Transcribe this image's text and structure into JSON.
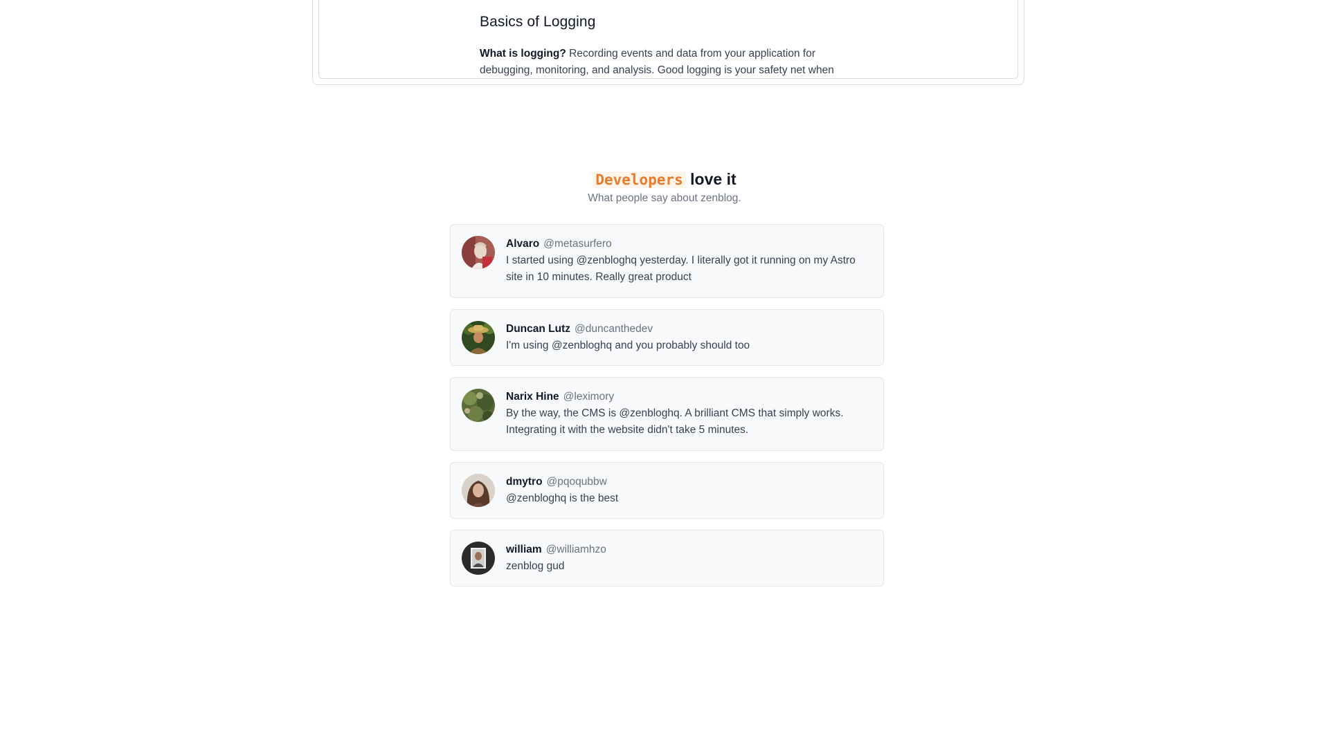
{
  "preview": {
    "title": "Basics of Logging",
    "lead_bold": "What is logging?",
    "lead_text": " Recording events and data from your application for debugging, monitoring, and analysis. Good logging is your safety net when"
  },
  "testimonials": {
    "heading_highlight": "Developers",
    "heading_rest": " love it",
    "subheading": "What people say about zenblog.",
    "items": [
      {
        "name": "Alvaro",
        "handle": "@metasurfero",
        "quote": "I started using @zenbloghq yesterday. I literally got it running on my Astro site in 10 minutes. Really great product",
        "avatar": "avatar-alvaro"
      },
      {
        "name": "Duncan Lutz",
        "handle": "@duncanthedev",
        "quote": "I'm using @zenbloghq and you probably should too",
        "avatar": "avatar-duncan"
      },
      {
        "name": "Narix Hine",
        "handle": "@leximory",
        "quote": "By the way, the CMS is @zenbloghq. A brilliant CMS that simply works. Integrating it with the website didn't take 5 minutes.",
        "avatar": "avatar-narix"
      },
      {
        "name": "dmytro",
        "handle": "@pqoqubbw",
        "quote": "@zenbloghq is the best",
        "avatar": "avatar-dmytro"
      },
      {
        "name": "william",
        "handle": "@williamhzo",
        "quote": "zenblog gud",
        "avatar": "avatar-william"
      }
    ]
  },
  "colors": {
    "accent": "#ea7a2c",
    "card_bg": "#f8f9fb",
    "card_border": "#e3e6eb",
    "muted_text": "#6b7280"
  }
}
